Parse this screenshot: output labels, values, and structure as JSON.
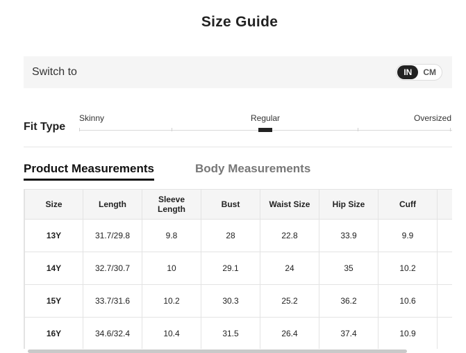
{
  "title": "Size Guide",
  "unit_switch": {
    "label": "Switch to",
    "options": [
      "IN",
      "CM"
    ],
    "selected": "IN"
  },
  "fit_type": {
    "label": "Fit Type",
    "options": [
      "Skinny",
      "Regular",
      "Oversized"
    ],
    "selected": "Regular"
  },
  "tabs": [
    {
      "label": "Product Measurements",
      "active": true
    },
    {
      "label": "Body Measurements",
      "active": false
    }
  ],
  "table": {
    "headers": [
      "Size",
      "Length",
      "Sleeve Length",
      "Bust",
      "Waist Size",
      "Hip Size",
      "Cuff",
      ""
    ],
    "rows": [
      [
        "13Y",
        "31.7/29.8",
        "9.8",
        "28",
        "22.8",
        "33.9",
        "9.9",
        ""
      ],
      [
        "14Y",
        "32.7/30.7",
        "10",
        "29.1",
        "24",
        "35",
        "10.2",
        ""
      ],
      [
        "15Y",
        "33.7/31.6",
        "10.2",
        "30.3",
        "25.2",
        "36.2",
        "10.6",
        ""
      ],
      [
        "16Y",
        "34.6/32.4",
        "10.4",
        "31.5",
        "26.4",
        "37.4",
        "10.9",
        ""
      ]
    ]
  }
}
